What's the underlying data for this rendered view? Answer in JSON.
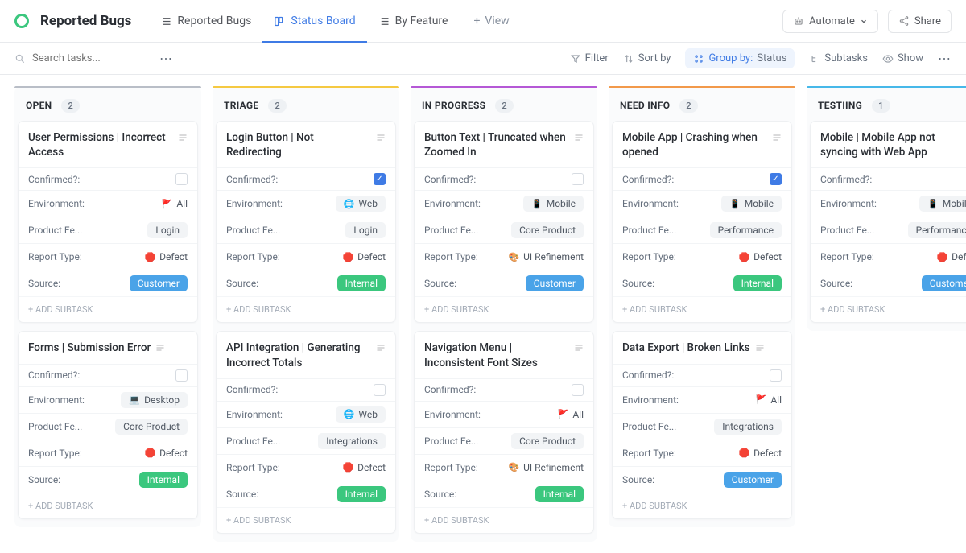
{
  "header": {
    "title": "Reported Bugs",
    "tabs": [
      {
        "label": "Reported Bugs",
        "icon": "list"
      },
      {
        "label": "Status Board",
        "icon": "board",
        "active": true
      },
      {
        "label": "By Feature",
        "icon": "list"
      }
    ],
    "add_view": "View",
    "automate": "Automate",
    "share": "Share"
  },
  "toolbar": {
    "search_placeholder": "Search tasks...",
    "filter": "Filter",
    "sort": "Sort by",
    "group_prefix": "Group by:",
    "group_value": "Status",
    "subtasks": "Subtasks",
    "show": "Show"
  },
  "add_subtask_label": "+ ADD SUBTASK",
  "field_labels": {
    "confirmed": "Confirmed?:",
    "environment": "Environment:",
    "product": "Product Fe...",
    "report_type": "Report Type:",
    "source": "Source:"
  },
  "columns": [
    {
      "name": "OPEN",
      "count": "2",
      "color": "#b9bec7",
      "cards": [
        {
          "title": "User Permissions | Incorrect Access",
          "confirmed": false,
          "environment": {
            "icon": "🚩",
            "text": "All",
            "boxed": false
          },
          "product": {
            "text": "Login"
          },
          "report_type": {
            "icon": "🛑",
            "text": "Defect",
            "boxed": false
          },
          "source": {
            "text": "Customer",
            "style": "blue"
          }
        },
        {
          "title": "Forms | Submission Error",
          "confirmed": false,
          "environment": {
            "icon": "💻",
            "text": "Desktop"
          },
          "product": {
            "text": "Core Product"
          },
          "report_type": {
            "icon": "🛑",
            "text": "Defect",
            "boxed": false
          },
          "source": {
            "text": "Internal",
            "style": "green"
          }
        }
      ]
    },
    {
      "name": "TRIAGE",
      "count": "2",
      "color": "#f5c942",
      "cards": [
        {
          "title": "Login Button | Not Redirecting",
          "confirmed": true,
          "environment": {
            "icon": "🌐",
            "text": "Web"
          },
          "product": {
            "text": "Login"
          },
          "report_type": {
            "icon": "🛑",
            "text": "Defect",
            "boxed": false
          },
          "source": {
            "text": "Internal",
            "style": "green"
          }
        },
        {
          "title": "API Integration | Generating Incorrect Totals",
          "confirmed": false,
          "environment": {
            "icon": "🌐",
            "text": "Web"
          },
          "product": {
            "text": "Integrations"
          },
          "report_type": {
            "icon": "🛑",
            "text": "Defect",
            "boxed": false
          },
          "source": {
            "text": "Internal",
            "style": "green"
          }
        }
      ]
    },
    {
      "name": "IN PROGRESS",
      "count": "2",
      "color": "#b558d6",
      "cards": [
        {
          "title": "Button Text | Truncated when Zoomed In",
          "confirmed": false,
          "environment": {
            "icon": "📱",
            "text": "Mobile"
          },
          "product": {
            "text": "Core Product"
          },
          "report_type": {
            "icon": "🎨",
            "text": "UI Refinement",
            "boxed": false
          },
          "source": {
            "text": "Customer",
            "style": "blue"
          }
        },
        {
          "title": "Navigation Menu | Inconsistent Font Sizes",
          "confirmed": false,
          "environment": {
            "icon": "🚩",
            "text": "All",
            "boxed": false
          },
          "product": {
            "text": "Core Product"
          },
          "report_type": {
            "icon": "🎨",
            "text": "UI Refinement",
            "boxed": false
          },
          "source": {
            "text": "Internal",
            "style": "green"
          }
        }
      ]
    },
    {
      "name": "NEED INFO",
      "count": "2",
      "color": "#f2994a",
      "cards": [
        {
          "title": "Mobile App | Crashing when opened",
          "confirmed": true,
          "environment": {
            "icon": "📱",
            "text": "Mobile"
          },
          "product": {
            "text": "Performance"
          },
          "report_type": {
            "icon": "🛑",
            "text": "Defect",
            "boxed": false
          },
          "source": {
            "text": "Internal",
            "style": "green"
          }
        },
        {
          "title": "Data Export | Broken Links",
          "confirmed": false,
          "environment": {
            "icon": "🚩",
            "text": "All",
            "boxed": false
          },
          "product": {
            "text": "Integrations"
          },
          "report_type": {
            "icon": "🛑",
            "text": "Defect",
            "boxed": false
          },
          "source": {
            "text": "Customer",
            "style": "blue"
          }
        }
      ]
    },
    {
      "name": "TESTIING",
      "count": "1",
      "color": "#46b8e9",
      "cards": [
        {
          "title": "Mobile | Mobile App not syncing with Web App",
          "confirmed": false,
          "environment": {
            "icon": "📱",
            "text": "Mobile"
          },
          "product": {
            "text": "Performance"
          },
          "report_type": {
            "icon": "🛑",
            "text": "Defect",
            "boxed": false
          },
          "source": {
            "text": "Customer",
            "style": "blue"
          }
        }
      ]
    }
  ]
}
